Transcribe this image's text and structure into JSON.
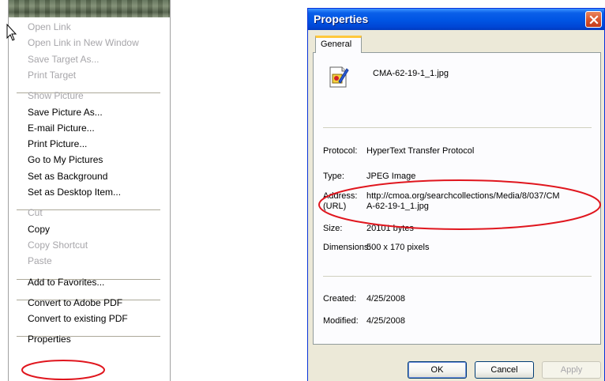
{
  "context_menu": {
    "groups": [
      {
        "items": [
          {
            "label": "Open Link",
            "disabled": true
          },
          {
            "label": "Open Link in New Window",
            "disabled": true
          },
          {
            "label": "Save Target As...",
            "disabled": true
          },
          {
            "label": "Print Target",
            "disabled": true
          }
        ]
      },
      {
        "items": [
          {
            "label": "Show Picture",
            "disabled": true
          },
          {
            "label": "Save Picture As...",
            "disabled": false
          },
          {
            "label": "E-mail Picture...",
            "disabled": false
          },
          {
            "label": "Print Picture...",
            "disabled": false
          },
          {
            "label": "Go to My Pictures",
            "disabled": false
          },
          {
            "label": "Set as Background",
            "disabled": false
          },
          {
            "label": "Set as Desktop Item...",
            "disabled": false
          }
        ]
      },
      {
        "items": [
          {
            "label": "Cut",
            "disabled": true
          },
          {
            "label": "Copy",
            "disabled": false
          },
          {
            "label": "Copy Shortcut",
            "disabled": true
          },
          {
            "label": "Paste",
            "disabled": true
          }
        ]
      },
      {
        "items": [
          {
            "label": "Add to Favorites...",
            "disabled": false
          }
        ]
      },
      {
        "items": [
          {
            "label": "Convert to Adobe PDF",
            "disabled": false
          },
          {
            "label": "Convert to existing PDF",
            "disabled": false
          }
        ]
      },
      {
        "items": [
          {
            "label": "Properties",
            "disabled": false,
            "highlighted_by_annotation": true
          }
        ]
      }
    ],
    "annotation_color": "#e0161e"
  },
  "dialog": {
    "title": "Properties",
    "close_icon": "close-icon",
    "tab": "General",
    "file_icon": "jpeg-file-icon",
    "filename": "CMA-62-19-1_1.jpg",
    "protocol_label": "Protocol:",
    "protocol_value": "HyperText Transfer Protocol",
    "type_label": "Type:",
    "type_value": "JPEG Image",
    "address_label_1": "Address:",
    "address_label_2": "(URL)",
    "address_line_1": "http://cmoa.org/searchcollections/Media/8/037/CM",
    "address_line_2": "A-62-19-1_1.jpg",
    "size_label": "Size:",
    "size_value": "20101 bytes",
    "dimensions_label": "Dimensions:",
    "dimensions_value": "500 x 170 pixels",
    "created_label": "Created:",
    "created_value": "4/25/2008",
    "modified_label": "Modified:",
    "modified_value": "4/25/2008",
    "buttons": {
      "ok": "OK",
      "cancel": "Cancel",
      "apply": "Apply"
    },
    "colors": {
      "titlebar": "#0054e3",
      "face": "#ece9d8",
      "annotation": "#e0161e"
    }
  }
}
